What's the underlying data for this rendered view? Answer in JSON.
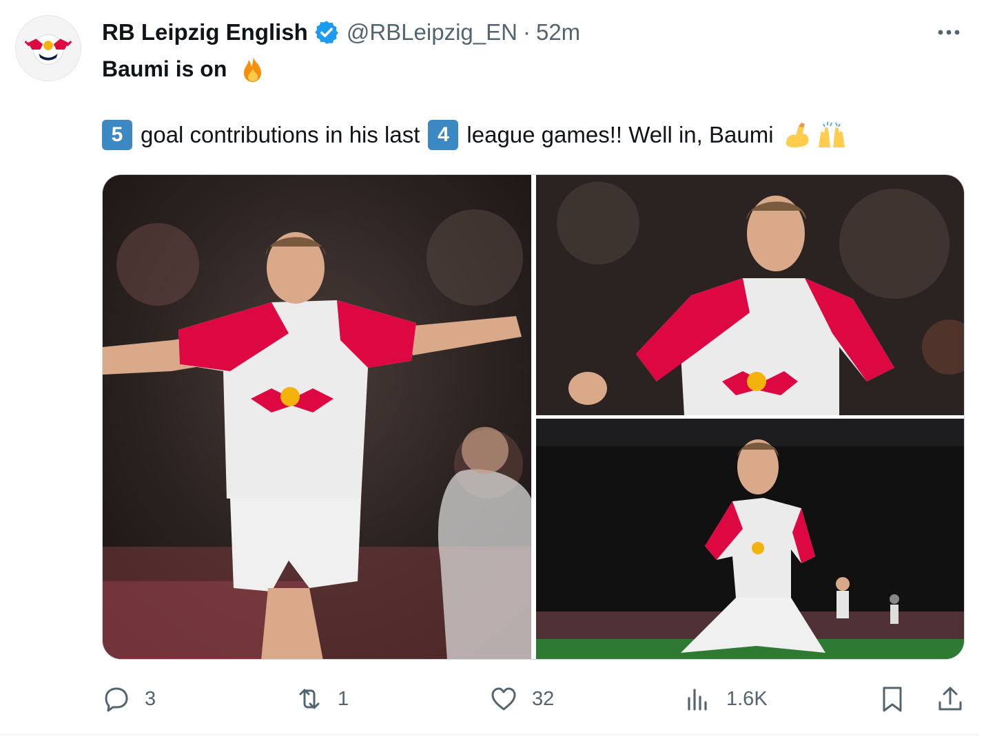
{
  "tweet": {
    "author_name": "RB Leipzig English",
    "handle": "@RBLeipzig_EN",
    "separator": "·",
    "timestamp": "52m",
    "line1": "Baumi is on",
    "line2_num1": "5",
    "line2_part1": "goal contributions in his last",
    "line2_num2": "4",
    "line2_part2": "league games!! Well in, Baumi",
    "emojis": [
      "fire-emoji",
      "flexed-biceps-emoji",
      "raising-hands-emoji"
    ]
  },
  "media": {
    "photos": [
      {
        "name": "player-celebrating-arms-wide"
      },
      {
        "name": "player-fist-pump"
      },
      {
        "name": "player-knee-slide-roar"
      }
    ]
  },
  "actions": {
    "replies": "3",
    "reposts": "1",
    "likes": "32",
    "views": "1.6K"
  },
  "colors": {
    "text": "#0f1419",
    "secondary": "#536471",
    "verified": "#1d9bf0",
    "brand_red": "#dd0741",
    "keycap": "#3b88c3"
  }
}
